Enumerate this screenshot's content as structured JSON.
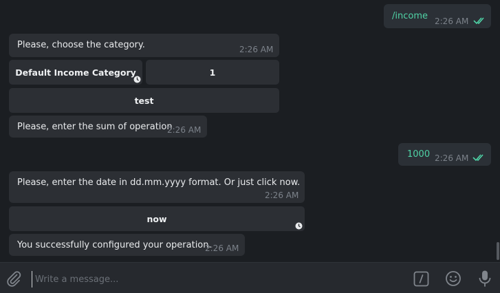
{
  "messages": [
    {
      "text": "/income",
      "time": "2:26 AM"
    },
    {
      "text": "Please, choose the category.",
      "time": "2:26 AM"
    },
    {
      "text": "Please, enter the sum of operation",
      "time": "2:26 AM"
    },
    {
      "text": "1000",
      "time": "2:26 AM"
    },
    {
      "text": "Please, enter the date in dd.mm.yyyy format. Or just click now.",
      "time": "2:26 AM"
    },
    {
      "text": "You successfully configured your operation.",
      "time": "2:26 AM"
    }
  ],
  "keyboard_buttons": {
    "default_income": "Default Income Category",
    "one": "1",
    "test": "test",
    "now": "now"
  },
  "composer": {
    "placeholder": "Write a message..."
  },
  "colors": {
    "background": "#1b1e22",
    "bubble": "#2c2f34",
    "outgoing_text": "#4fd3a6",
    "read_check": "#4fd3a6"
  },
  "icons": {
    "attach": "paperclip-icon",
    "commands": "slash-command-icon",
    "emoji": "emoji-icon",
    "voice": "microphone-icon"
  }
}
